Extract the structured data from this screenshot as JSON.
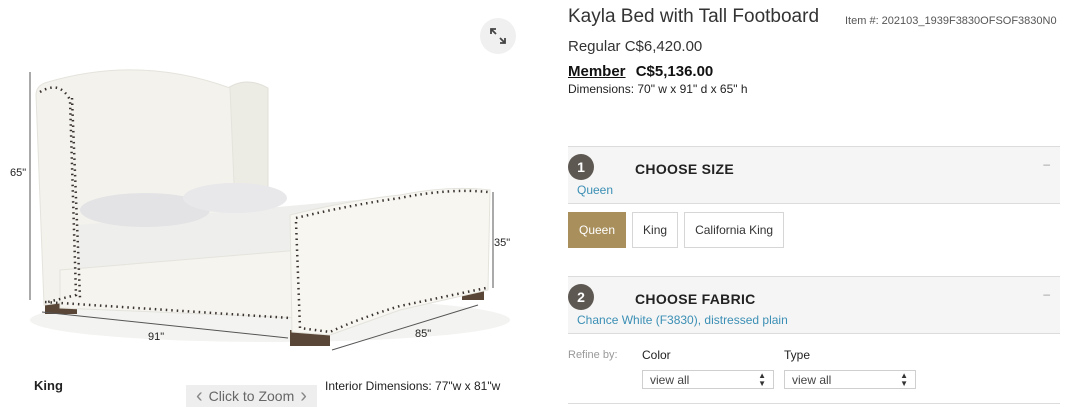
{
  "product": {
    "title": "Kayla Bed with Tall Footboard",
    "item_number": "Item #: 202103_1939F3830OFSOF3830N0",
    "regular_price": "Regular C$6,420.00",
    "member_label": "Member",
    "member_price": "C$5,136.00",
    "dimensions": "Dimensions: 70\" w x 91\" d x 65\" h"
  },
  "image": {
    "dim_height": "65\"",
    "dim_footboard": "35\"",
    "dim_length": "91\"",
    "dim_width": "85\"",
    "size_caption": "King",
    "zoom_label": "Click to Zoom",
    "interior": "Interior Dimensions:  77\"w x 81\"w",
    "icons": {
      "expand": "expand-icon",
      "prev": "chevron-left-icon",
      "next": "chevron-right-icon"
    }
  },
  "size_section": {
    "number": "1",
    "title": "CHOOSE SIZE",
    "selected": "Queen",
    "collapse": "–",
    "options": [
      "Queen",
      "King",
      "California King"
    ],
    "active_index": 0
  },
  "fabric_section": {
    "number": "2",
    "title": "CHOOSE FABRIC",
    "selected": "Chance White (F3830), distressed plain",
    "collapse": "–"
  },
  "refine": {
    "label": "Refine by:",
    "color_label": "Color",
    "color_value": "view all",
    "type_label": "Type",
    "type_value": "view all"
  },
  "colors": {
    "accent_gold": "#a88f5c",
    "link_blue": "#3b8fb5",
    "step_badge": "#5e5852"
  }
}
